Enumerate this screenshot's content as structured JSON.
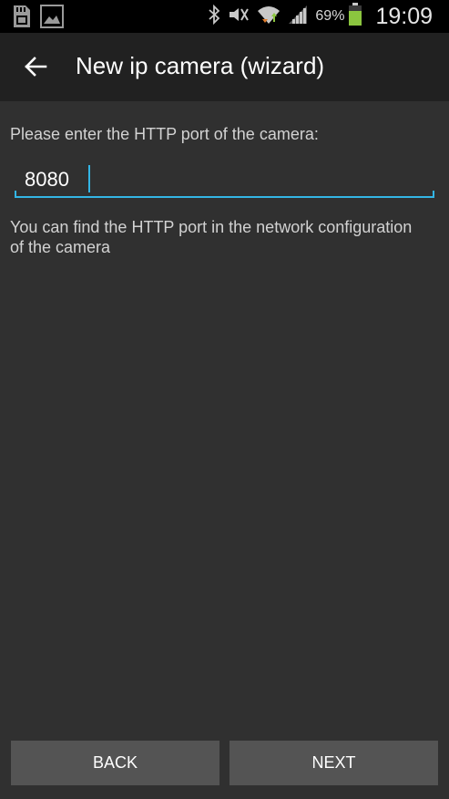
{
  "status_bar": {
    "battery_percent": "69%",
    "time": "19:09",
    "icons": [
      "sd-card-icon",
      "image-notification-icon",
      "bluetooth-icon",
      "mute-icon",
      "wifi-icon",
      "signal-icon",
      "battery-icon"
    ],
    "battery_color": "#8bc53f"
  },
  "app_bar": {
    "title": "New ip camera (wizard)"
  },
  "form": {
    "prompt": "Please enter the HTTP port of the camera:",
    "port_value": "8080",
    "hint": "You can find the HTTP port in the network configuration of the camera",
    "accent_color": "#33b5e5"
  },
  "buttons": {
    "back_label": "BACK",
    "next_label": "NEXT"
  }
}
